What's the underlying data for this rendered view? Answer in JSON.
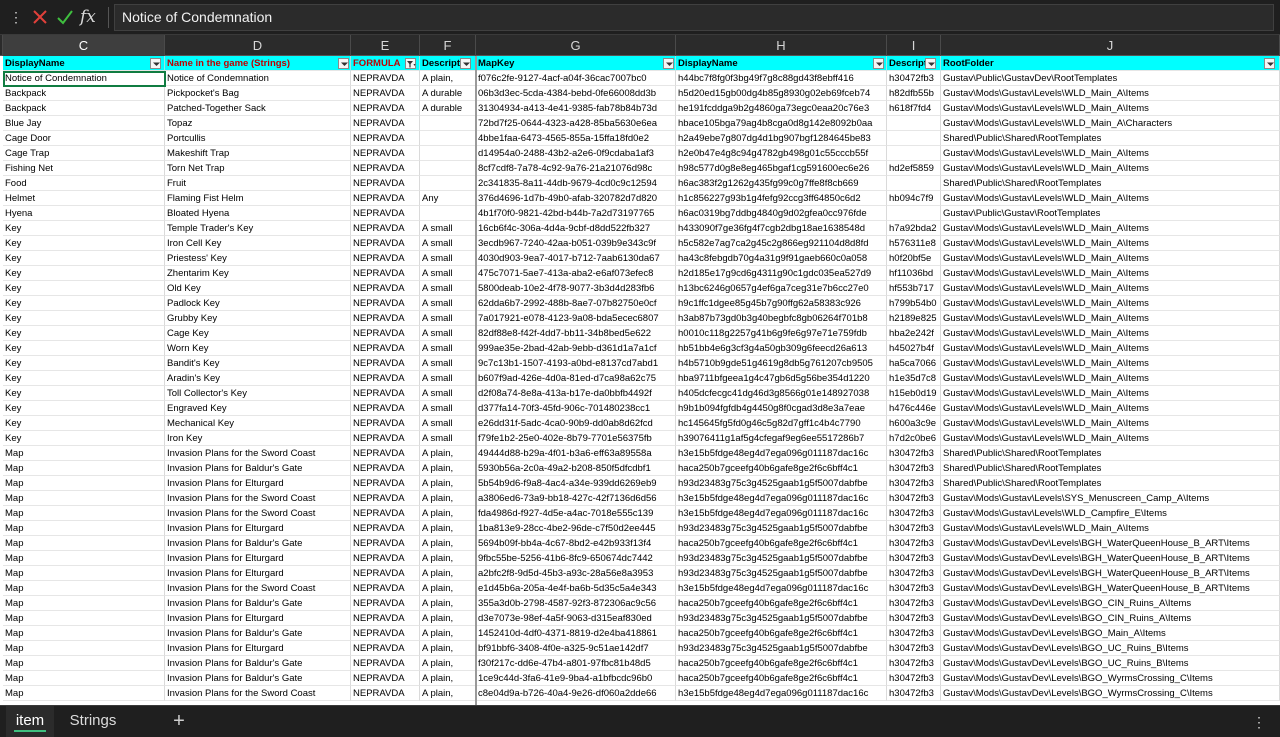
{
  "formula_bar": {
    "cancel_icon": "x-icon",
    "enter_icon": "check-icon",
    "function_label": "fx",
    "value": "Notice of Condemnation",
    "accent_cancel": "#e0403a",
    "accent_enter": "#3fbf3f"
  },
  "columns": [
    "C",
    "D",
    "E",
    "F",
    "G",
    "H",
    "I",
    "J"
  ],
  "selected_column": "C",
  "header": [
    "DisplayName",
    "Name in the game (Strings)",
    "FORMULA",
    "Descript",
    "MapKey",
    "DisplayName",
    "Descript",
    "RootFolder"
  ],
  "header_color": "#00ffff",
  "rows": [
    [
      "Notice of Condemnation",
      "Notice of Condemnation",
      "NEPRAVDA",
      "A plain,",
      "f076c2fe-9127-4acf-a04f-36cac7007bc0",
      "h44bc7f8fg0f3bg49f7g8c88gd43f8ebff416",
      "h30472fb3",
      "Gustav\\Public\\GustavDev\\RootTemplates"
    ],
    [
      "Backpack",
      "Pickpocket's Bag",
      "NEPRAVDA",
      "A durable",
      "06b3d3ec-5cda-4384-bebd-0fe66008dd3b",
      "h5d20ed15gb00dg4b85g8930g02eb69fceb74",
      "h82dfb55b",
      "Gustav\\Mods\\Gustav\\Levels\\WLD_Main_A\\Items"
    ],
    [
      "Backpack",
      "Patched-Together Sack",
      "NEPRAVDA",
      "A durable",
      "31304934-a413-4e41-9385-fab78b84b73d",
      "he191fcddga9b2g4860ga73egc0eaa20c76e3",
      "h618f7fd4",
      "Gustav\\Mods\\Gustav\\Levels\\WLD_Main_A\\Items"
    ],
    [
      "Blue Jay",
      "Topaz",
      "NEPRAVDA",
      "",
      "72bd7f25-0644-4323-a428-85ba5630e6ea",
      "hbace105bga79ag4b8cga0d8g142e8092b0aa",
      "",
      "Gustav\\Mods\\Gustav\\Levels\\WLD_Main_A\\Characters"
    ],
    [
      "Cage Door",
      "Portcullis",
      "NEPRAVDA",
      "",
      "4bbe1faa-6473-4565-855a-15ffa18fd0e2",
      "h2a49ebe7g807dg4d1bg907bgf1284645be83",
      "",
      "Shared\\Public\\Shared\\RootTemplates"
    ],
    [
      "Cage Trap",
      "Makeshift Trap",
      "NEPRAVDA",
      "",
      "d14954a0-2488-43b2-a2e6-0f9cdaba1af3",
      "h2e0b47e4g8c94g4782gb498g01c55cccb55f",
      "",
      "Gustav\\Mods\\Gustav\\Levels\\WLD_Main_A\\Items"
    ],
    [
      "Fishing Net",
      "Torn Net Trap",
      "NEPRAVDA",
      "",
      "8cf7cdf8-7a78-4c92-9a76-21a21076d98c",
      "h98c577d0g8e8eg465bgaf1cg591600ec6e26",
      "hd2ef5859",
      "Gustav\\Mods\\Gustav\\Levels\\WLD_Main_A\\Items"
    ],
    [
      "Food",
      "Fruit",
      "NEPRAVDA",
      "",
      "2c341835-8a11-44db-9679-4cd0c9c12594",
      "h6ac383f2g1262g435fg99c0g7ffe8f8cb669",
      "",
      "Shared\\Public\\Shared\\RootTemplates"
    ],
    [
      "Helmet",
      "Flaming Fist Helm",
      "NEPRAVDA",
      "Any",
      "376d4696-1d7b-49b0-afab-320782d7d820",
      "h1c856227g93b1g4fefg92ccg3ff64850c6d2",
      "hb094c7f9",
      "Gustav\\Mods\\Gustav\\Levels\\WLD_Main_A\\Items"
    ],
    [
      "Hyena",
      "Bloated Hyena",
      "NEPRAVDA",
      "",
      "4b1f70f0-9821-42bd-b44b-7a2d73197765",
      "h6ac0319bg7ddbg4840g9d02gfea0cc976fde",
      "",
      "Gustav\\Public\\Gustav\\RootTemplates"
    ],
    [
      "Key",
      "Temple Trader's Key",
      "NEPRAVDA",
      "A small",
      "16cb6f4c-306a-4d4a-9cbf-d8dd522fb327",
      "h433090f7ge36fg4f7cgb2dbg18ae1638548d",
      "h7a92bda2",
      "Gustav\\Mods\\Gustav\\Levels\\WLD_Main_A\\Items"
    ],
    [
      "Key",
      "Iron Cell Key",
      "NEPRAVDA",
      "A small",
      "3ecdb967-7240-42aa-b051-039b9e343c9f",
      "h5c582e7ag7ca2g45c2g866eg921104d8d8fd",
      "h576311e8",
      "Gustav\\Mods\\Gustav\\Levels\\WLD_Main_A\\Items"
    ],
    [
      "Key",
      "Priestess' Key",
      "NEPRAVDA",
      "A small",
      "4030d903-9ea7-4017-b712-7aab6130da67",
      "ha43c8febgdb70g4a31g9f91gaeb660c0a058",
      "h0f20bf5e",
      "Gustav\\Mods\\Gustav\\Levels\\WLD_Main_A\\Items"
    ],
    [
      "Key",
      "Zhentarim Key",
      "NEPRAVDA",
      "A small",
      "475c7071-5ae7-413a-aba2-e6af073efec8",
      "h2d185e17g9cd6g4311g90c1gdc035ea527d9",
      "hf11036bd",
      "Gustav\\Mods\\Gustav\\Levels\\WLD_Main_A\\Items"
    ],
    [
      "Key",
      "Old Key",
      "NEPRAVDA",
      "A small",
      "5800deab-10e2-4f78-9077-3b3d4d283fb6",
      "h13bc6246g0657g4ef6ga7ceg31e7b6cc27e0",
      "hf553b717",
      "Gustav\\Mods\\Gustav\\Levels\\WLD_Main_A\\Items"
    ],
    [
      "Key",
      "Padlock Key",
      "NEPRAVDA",
      "A small",
      "62dda6b7-2992-488b-8ae7-07b82750e0cf",
      "h9c1ffc1dgee85g45b7g90ffg62a58383c926",
      "h799b54b0",
      "Gustav\\Mods\\Gustav\\Levels\\WLD_Main_A\\Items"
    ],
    [
      "Key",
      "Grubby Key",
      "NEPRAVDA",
      "A small",
      "7a017921-e078-4123-9a08-bda5ecec6807",
      "h3ab87b73gd0b3g40begbfc8gb06264f701b8",
      "h2189e825",
      "Gustav\\Mods\\Gustav\\Levels\\WLD_Main_A\\Items"
    ],
    [
      "Key",
      "Cage Key",
      "NEPRAVDA",
      "A small",
      "82df88e8-f42f-4dd7-bb11-34b8bed5e622",
      "h0010c118g2257g41b6g9fe6g97e71e759fdb",
      "hba2e242f",
      "Gustav\\Mods\\Gustav\\Levels\\WLD_Main_A\\Items"
    ],
    [
      "Key",
      "Worn Key",
      "NEPRAVDA",
      "A small",
      "999ae35e-2bad-42ab-9ebb-d361d1a7a1cf",
      "hb51bb4e6g3cf3g4a50gb309g6feecd26a613",
      "h45027b4f",
      "Gustav\\Mods\\Gustav\\Levels\\WLD_Main_A\\Items"
    ],
    [
      "Key",
      "Bandit's Key",
      "NEPRAVDA",
      "A small",
      "9c7c13b1-1507-4193-a0bd-e8137cd7abd1",
      "h4b5710b9gde51g4619g8db5g761207cb9505",
      "ha5ca7066",
      "Gustav\\Mods\\Gustav\\Levels\\WLD_Main_A\\Items"
    ],
    [
      "Key",
      "Aradin's Key",
      "NEPRAVDA",
      "A small",
      "b607f9ad-426e-4d0a-81ed-d7ca98a62c75",
      "hba9711bfgeea1g4c47gb6d5g56be354d1220",
      "h1e35d7c8",
      "Gustav\\Mods\\Gustav\\Levels\\WLD_Main_A\\Items"
    ],
    [
      "Key",
      "Toll Collector's Key",
      "NEPRAVDA",
      "A small",
      "d2f08a74-8e8a-413a-b17e-da0bbfb4492f",
      "h405dcfecgc41dg46d3g8566g01e148927038",
      "h15eb0d19",
      "Gustav\\Mods\\Gustav\\Levels\\WLD_Main_A\\Items"
    ],
    [
      "Key",
      "Engraved Key",
      "NEPRAVDA",
      "A small",
      "d377fa14-70f3-45fd-906c-701480238cc1",
      "h9b1b094fgfdb4g4450g8f0cgad3d8e3a7eae",
      "h476c446e",
      "Gustav\\Mods\\Gustav\\Levels\\WLD_Main_A\\Items"
    ],
    [
      "Key",
      "Mechanical Key",
      "NEPRAVDA",
      "A small",
      "e26dd31f-5adc-4ca0-90b9-dd0ab8d62fcd",
      "hc145645fg5fd0g46c5g82d7gff1c4b4c7790",
      "h600a3c9e",
      "Gustav\\Mods\\Gustav\\Levels\\WLD_Main_A\\Items"
    ],
    [
      "Key",
      "Iron Key",
      "NEPRAVDA",
      "A small",
      "f79fe1b2-25e0-402e-8b79-7701e56375fb",
      "h39076411g1af5g4cfegaf9eg6ee5517286b7",
      "h7d2c0be6",
      "Gustav\\Mods\\Gustav\\Levels\\WLD_Main_A\\Items"
    ],
    [
      "Map",
      "Invasion Plans for the Sword Coast",
      "NEPRAVDA",
      "A plain,",
      "49444d88-b29a-4f01-b3a6-eff63a89558a",
      "h3e15b5fdge48eg4d7ega096g011187dac16c",
      "h30472fb3",
      "Shared\\Public\\Shared\\RootTemplates"
    ],
    [
      "Map",
      "Invasion Plans for Baldur's Gate",
      "NEPRAVDA",
      "A plain,",
      "5930b56a-2c0a-49a2-b208-850f5dfcdbf1",
      "haca250b7gceefg40b6gafe8ge2f6c6bff4c1",
      "h30472fb3",
      "Shared\\Public\\Shared\\RootTemplates"
    ],
    [
      "Map",
      "Invasion Plans for Elturgard",
      "NEPRAVDA",
      "A plain,",
      "5b54b9d6-f9a8-4ac4-a34e-939dd6269eb9",
      "h93d23483g75c3g4525gaab1g5f5007dabfbe",
      "h30472fb3",
      "Shared\\Public\\Shared\\RootTemplates"
    ],
    [
      "Map",
      "Invasion Plans for the Sword Coast",
      "NEPRAVDA",
      "A plain,",
      "a3806ed6-73a9-bb18-427c-42f7136d6d56",
      "h3e15b5fdge48eg4d7ega096g011187dac16c",
      "h30472fb3",
      "Gustav\\Mods\\Gustav\\Levels\\SYS_Menuscreen_Camp_A\\Items"
    ],
    [
      "Map",
      "Invasion Plans for the Sword Coast",
      "NEPRAVDA",
      "A plain,",
      "fda4986d-f927-4d5e-a4ac-7018e555c139",
      "h3e15b5fdge48eg4d7ega096g011187dac16c",
      "h30472fb3",
      "Gustav\\Mods\\Gustav\\Levels\\WLD_Campfire_E\\Items"
    ],
    [
      "Map",
      "Invasion Plans for Elturgard",
      "NEPRAVDA",
      "A plain,",
      "1ba813e9-28cc-4be2-96de-c7f50d2ee445",
      "h93d23483g75c3g4525gaab1g5f5007dabfbe",
      "h30472fb3",
      "Gustav\\Mods\\Gustav\\Levels\\WLD_Main_A\\Items"
    ],
    [
      "Map",
      "Invasion Plans for Baldur's Gate",
      "NEPRAVDA",
      "A plain,",
      "5694b09f-bb4a-4c67-8bd2-e42b933f13f4",
      "haca250b7gceefg40b6gafe8ge2f6c6bff4c1",
      "h30472fb3",
      "Gustav\\Mods\\GustavDev\\Levels\\BGH_WaterQueenHouse_B_ART\\Items"
    ],
    [
      "Map",
      "Invasion Plans for Elturgard",
      "NEPRAVDA",
      "A plain,",
      "9fbc55be-5256-41b6-8fc9-650674dc7442",
      "h93d23483g75c3g4525gaab1g5f5007dabfbe",
      "h30472fb3",
      "Gustav\\Mods\\GustavDev\\Levels\\BGH_WaterQueenHouse_B_ART\\Items"
    ],
    [
      "Map",
      "Invasion Plans for Elturgard",
      "NEPRAVDA",
      "A plain,",
      "a2bfc2f8-9d5d-45b3-a93c-28a56e8a3953",
      "h93d23483g75c3g4525gaab1g5f5007dabfbe",
      "h30472fb3",
      "Gustav\\Mods\\GustavDev\\Levels\\BGH_WaterQueenHouse_B_ART\\Items"
    ],
    [
      "Map",
      "Invasion Plans for the Sword Coast",
      "NEPRAVDA",
      "A plain,",
      "e1d45b6a-205a-4e4f-ba6b-5d35c5a4e343",
      "h3e15b5fdge48eg4d7ega096g011187dac16c",
      "h30472fb3",
      "Gustav\\Mods\\GustavDev\\Levels\\BGH_WaterQueenHouse_B_ART\\Items"
    ],
    [
      "Map",
      "Invasion Plans for Baldur's Gate",
      "NEPRAVDA",
      "A plain,",
      "355a3d0b-2798-4587-92f3-872306ac9c56",
      "haca250b7gceefg40b6gafe8ge2f6c6bff4c1",
      "h30472fb3",
      "Gustav\\Mods\\GustavDev\\Levels\\BGO_CIN_Ruins_A\\Items"
    ],
    [
      "Map",
      "Invasion Plans for Elturgard",
      "NEPRAVDA",
      "A plain,",
      "d3e7073e-98ef-4a5f-9063-d315eaf830ed",
      "h93d23483g75c3g4525gaab1g5f5007dabfbe",
      "h30472fb3",
      "Gustav\\Mods\\GustavDev\\Levels\\BGO_CIN_Ruins_A\\Items"
    ],
    [
      "Map",
      "Invasion Plans for Baldur's Gate",
      "NEPRAVDA",
      "A plain,",
      "1452410d-4df0-4371-8819-d2e4ba418861",
      "haca250b7gceefg40b6gafe8ge2f6c6bff4c1",
      "h30472fb3",
      "Gustav\\Mods\\GustavDev\\Levels\\BGO_Main_A\\Items"
    ],
    [
      "Map",
      "Invasion Plans for Elturgard",
      "NEPRAVDA",
      "A plain,",
      "bf91bbf6-3408-4f0e-a325-9c51ae142df7",
      "h93d23483g75c3g4525gaab1g5f5007dabfbe",
      "h30472fb3",
      "Gustav\\Mods\\GustavDev\\Levels\\BGO_UC_Ruins_B\\Items"
    ],
    [
      "Map",
      "Invasion Plans for Baldur's Gate",
      "NEPRAVDA",
      "A plain,",
      "f30f217c-dd6e-47b4-a801-97fbc81b48d5",
      "haca250b7gceefg40b6gafe8ge2f6c6bff4c1",
      "h30472fb3",
      "Gustav\\Mods\\GustavDev\\Levels\\BGO_UC_Ruins_B\\Items"
    ],
    [
      "Map",
      "Invasion Plans for Baldur's Gate",
      "NEPRAVDA",
      "A plain,",
      "1ce9c44d-3fa6-41e9-9ba4-a1bfbcdc96b0",
      "haca250b7gceefg40b6gafe8ge2f6c6bff4c1",
      "h30472fb3",
      "Gustav\\Mods\\GustavDev\\Levels\\BGO_WyrmsCrossing_C\\Items"
    ],
    [
      "Map",
      "Invasion Plans for the Sword Coast",
      "NEPRAVDA",
      "A plain,",
      "c8e04d9a-b726-40a4-9e26-df060a2dde66",
      "h3e15b5fdge48eg4d7ega096g011187dac16c",
      "h30472fb3",
      "Gustav\\Mods\\GustavDev\\Levels\\BGO_WyrmsCrossing_C\\Items"
    ]
  ],
  "sheet_tabs": [
    "item",
    "Strings"
  ],
  "active_tab": "item",
  "add_sheet_label": "+"
}
